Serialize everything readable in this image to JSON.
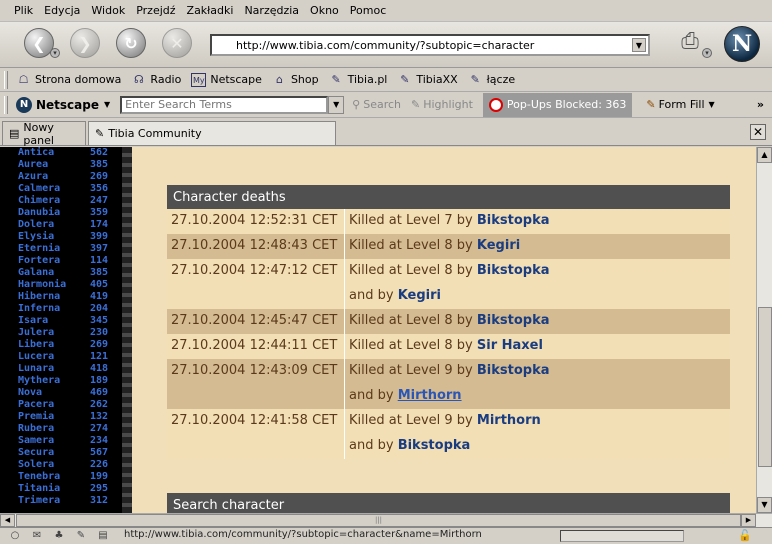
{
  "menu": [
    "Plik",
    "Edycja",
    "Widok",
    "Przejdź",
    "Zakładki",
    "Narzędzia",
    "Okno",
    "Pomoc"
  ],
  "url": "http://www.tibia.com/community/?subtopic=character",
  "bookmarks": [
    "Strona domowa",
    "Radio",
    "Netscape",
    "Shop",
    "Tibia.pl",
    "TibiaXX",
    "łącze"
  ],
  "searchbar": {
    "brand": "Netscape",
    "placeholder": "Enter Search Terms",
    "search_label": "Search",
    "highlight_label": "Highlight",
    "popups_label": "Pop-Ups Blocked: 363",
    "formfill_label": "Form Fill"
  },
  "tabs": [
    "Nowy panel",
    "Tibia Community"
  ],
  "worlds": [
    [
      "Antica",
      "562"
    ],
    [
      "Aurea",
      "385"
    ],
    [
      "Azura",
      "269"
    ],
    [
      "Calmera",
      "356"
    ],
    [
      "Chimera",
      "247"
    ],
    [
      "Danubia",
      "359"
    ],
    [
      "Dolera",
      "174"
    ],
    [
      "Elysia",
      "399"
    ],
    [
      "Eternia",
      "397"
    ],
    [
      "Fortera",
      "114"
    ],
    [
      "Galana",
      "385"
    ],
    [
      "Harmonia",
      "405"
    ],
    [
      "Hiberna",
      "419"
    ],
    [
      "Inferna",
      "204"
    ],
    [
      "Isara",
      "345"
    ],
    [
      "Julera",
      "230"
    ],
    [
      "Libera",
      "269"
    ],
    [
      "Lucera",
      "121"
    ],
    [
      "Lunara",
      "418"
    ],
    [
      "Mythera",
      "189"
    ],
    [
      "Nova",
      "469"
    ],
    [
      "Pacera",
      "262"
    ],
    [
      "Premia",
      "132"
    ],
    [
      "Rubera",
      "274"
    ],
    [
      "Samera",
      "234"
    ],
    [
      "Secura",
      "567"
    ],
    [
      "Solera",
      "226"
    ],
    [
      "Tenebra",
      "199"
    ],
    [
      "Titania",
      "295"
    ],
    [
      "Trimera",
      "312"
    ]
  ],
  "deaths": {
    "title": "Character deaths",
    "rows": [
      {
        "date": "27.10.2004 12:52:31 CET",
        "desc": "Killed at Level 7 by",
        "who": "Bikstopka",
        "shade": "a"
      },
      {
        "date": "27.10.2004 12:48:43 CET",
        "desc": "Killed at Level 8 by",
        "who": "Kegiri",
        "shade": "b"
      },
      {
        "date": "27.10.2004 12:47:12 CET",
        "desc": "Killed at Level 8 by",
        "who": "Bikstopka",
        "shade": "a"
      },
      {
        "date": "",
        "desc": "and by",
        "who": "Kegiri",
        "shade": "a"
      },
      {
        "date": "27.10.2004 12:45:47 CET",
        "desc": "Killed at Level 8 by",
        "who": "Bikstopka",
        "shade": "b"
      },
      {
        "date": "27.10.2004 12:44:11 CET",
        "desc": "Killed at Level 8 by",
        "who": "Sir Haxel",
        "shade": "a"
      },
      {
        "date": "27.10.2004 12:43:09 CET",
        "desc": "Killed at Level 9 by",
        "who": "Bikstopka",
        "shade": "b"
      },
      {
        "date": "",
        "desc": "and by",
        "who": "Mirthorn",
        "shade": "b",
        "link": true
      },
      {
        "date": "27.10.2004 12:41:58 CET",
        "desc": "Killed at Level 9 by",
        "who": "Mirthorn",
        "shade": "a"
      },
      {
        "date": "",
        "desc": "and by",
        "who": "Bikstopka",
        "shade": "a"
      }
    ]
  },
  "search_section": {
    "title": "Search character"
  },
  "status": {
    "text": "http://www.tibia.com/community/?subtopic=character&name=Mirthorn"
  }
}
